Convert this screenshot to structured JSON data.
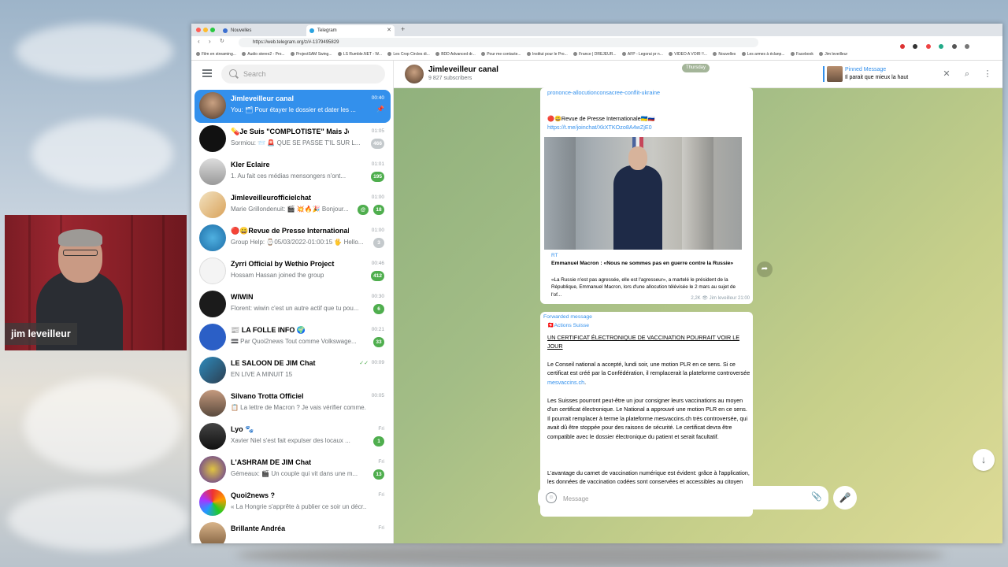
{
  "browser": {
    "tabs": [
      {
        "label": "Nouvelles"
      },
      {
        "label": "Telegram"
      }
    ],
    "new_tab": "+",
    "url": "https://web.telegram.org/z/#-1379495829",
    "bookmarks": [
      "Film en streaming...",
      "Audio stereo2 - Pro...",
      "ProjectSAM Swing...",
      "LS Rumble.NET - W...",
      "Les Crop Circles di...",
      "BDD Advanced dr...",
      "Pour me contacte...",
      "Institut pour le Pro...",
      "France | DREJEUR...",
      "AFP - Legorai pr n...",
      "VIDEO A VOIR !!...",
      "Nouvelles",
      "Les armes à éclanp...",
      "Facebook",
      "Jim leveilleur"
    ]
  },
  "sidebar": {
    "search_placeholder": "Search",
    "chats": [
      {
        "name": "Jimleveilleur canal",
        "message": "You: 🗂 Pour étayer le dossier et dater les ...",
        "time": "00:40",
        "badge": "",
        "active": true,
        "pinned_icon": "📌"
      },
      {
        "name": "💊Je Suis \"COMPLOTISTE\" Mais Je...",
        "message": "Sormiou: 📨 🚨 QUE SE PASSE T'IL SUR L...",
        "time": "01:05",
        "badge": "466",
        "muted": true
      },
      {
        "name": "Kler Eclaire",
        "message": "1. Au fait ces médias mensongers n'ont...",
        "time": "01:01",
        "badge": "195"
      },
      {
        "name": "Jimleveilleurofficielchat",
        "message": "Marie Grillondenuit: 🎬 💥🔥🎉 Bonjour...",
        "time": "01:00",
        "badge": "18",
        "mention": "@"
      },
      {
        "name": "🔴😀Revue de Presse Internationale...",
        "message": "Group Help: ⌚05/03/2022-01:00:15 🖐 Hello...",
        "time": "01:00",
        "badge": "3",
        "muted": true
      },
      {
        "name": "Zyrri Official by Wethio Project",
        "message": "Hossam Hassan joined the group",
        "time": "00:46",
        "badge": "412"
      },
      {
        "name": "WIWIN",
        "message": "Florent: wiwin c'est un autre actif que tu pou...",
        "time": "00:30",
        "badge": "6"
      },
      {
        "name": "📰 LA FOLLE INFO 🌍",
        "message": "🟰 Par Quoi2news Tout comme Volkswage...",
        "time": "00:21",
        "badge": "33"
      },
      {
        "name": "LE SALOON DE JIM Chat",
        "message": "EN LIVE A MINUIT 15",
        "time": "00:09",
        "badge": "",
        "check": "✓✓"
      },
      {
        "name": "Silvano Trotta Officiel",
        "message": "📋 La lettre de Macron ? Je vais vérifier comme...",
        "time": "00:05",
        "badge": ""
      },
      {
        "name": "Lyo 🐾",
        "message": "Xavier Niel s'est fait expulser des locaux ...",
        "time": "Fri",
        "badge": "1"
      },
      {
        "name": "L'ASHRAM DE JIM Chat",
        "message": "Gémeaux: 🎬 Un couple qui vit dans une m...",
        "time": "Fri",
        "badge": "13"
      },
      {
        "name": "Quoi2news ?",
        "message": "« La Hongrie s'apprête à publier ce soir un décr...",
        "time": "Fri",
        "badge": ""
      },
      {
        "name": "Brillante Andréa",
        "message": "",
        "time": "Fri",
        "badge": ""
      }
    ]
  },
  "header": {
    "title": "Jimleveilleur canal",
    "subtitle": "9 827 subscribers",
    "pinned_title": "Pinned Message",
    "pinned_text": "Il parait que mieux la haut"
  },
  "messages": {
    "top_link": "prononce-allocutionconsacree-conflit-ukraine",
    "date_pill": "Thursday",
    "post1_title": "🔴😀Revue de Presse Internationale🇺🇦🇷🇺",
    "post1_link": "https://t.me/joinchat/XkXTKOzo8A4wZjE0",
    "post1_source": "RT",
    "post1_headline": "Emmanuel Macron : «Nous ne sommes pas en guerre contre la Russie»",
    "post1_body": "«La Russie n'est pas agressée, elle est l'agresseur», a martelé le président de la République, Emmanuel Macron, lors d'une allocution télévisée le 2 mars au sujet de l'of...",
    "post1_meta": "2,2K 👁 Jim leveilleur 21:00",
    "post2_forwarded": "Forwarded message",
    "post2_from": "🇨🇭Actions Suisse",
    "post2_title": "UN CERTIFICAT ÉLECTRONIQUE DE VACCINATION POURRAIT VOIR LE JOUR",
    "post2_p1a": "Le Conseil national a accepté, lundi soir, une motion PLR en ce sens. Si ce certificat est créé par la Confédération, il remplacerait la plateforme controversée ",
    "post2_p1link": "mesvaccins.ch",
    "post2_p2": "Les Suisses pourront peut-être un jour consigner leurs vaccinations au moyen d'un certificat électronique. Le National a approuvé une motion PLR en ce sens. Il pourrait remplacer à terme la plateforme mesvaccins.ch très controversée, qui avait dû être stoppée pour des raisons de sécurité. Le certificat devra être compatible avec le dossier électronique du patient et serait facultatif.",
    "post2_p3": "L'avantage du carnet de vaccination numérique est évident: grâce à l'application, les données de vaccination codées sont conservées et accessibles au citoyen partout et à tout moment. Grâce à des mises à jour permanentes, le citoyen sera toujours"
  },
  "composer": {
    "placeholder": "Message"
  },
  "webcam": {
    "label": "jim leveilleur"
  },
  "colors": {
    "accent": "#3390ec",
    "badge": "#4fae4e",
    "badge_muted": "#c4c9cc"
  }
}
